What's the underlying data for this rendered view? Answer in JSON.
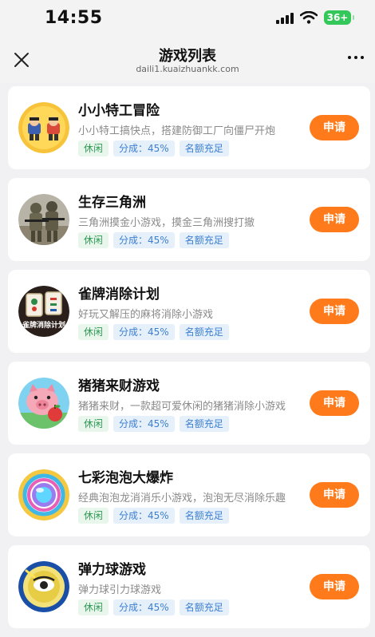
{
  "status_bar": {
    "time": "14:55",
    "battery": "36+",
    "icons": [
      "signal-icon",
      "wifi-icon",
      "battery-icon"
    ]
  },
  "nav": {
    "title": "游戏列表",
    "subtitle": "daili1.kuaizhuankk.com",
    "icons": [
      "close-icon",
      "more-icon"
    ]
  },
  "colors": {
    "accent": "#ff7a1a",
    "tag_green_bg": "#e8f6ec",
    "tag_green_text": "#2e9a55",
    "tag_blue_bg": "#e6f0fb",
    "tag_blue_text": "#3c7fd0",
    "background": "#f1f1f3"
  },
  "games": [
    {
      "name": "小小特工冒险",
      "desc": "小小特工搞快点，搭建防御工厂向僵尸开炮",
      "tags": [
        "休闲",
        "分成：45%",
        "名额充足"
      ],
      "button": "申请",
      "avatar_icon": "agents-icon"
    },
    {
      "name": "生存三角洲",
      "desc": "三角洲摸金小游戏，摸金三角洲搜打撤",
      "tags": [
        "休闲",
        "分成：45%",
        "名额充足"
      ],
      "button": "申请",
      "avatar_icon": "soldiers-icon"
    },
    {
      "name": "雀牌消除计划",
      "desc": "好玩又解压的麻将消除小游戏",
      "tags": [
        "休闲",
        "分成：45%",
        "名额充足"
      ],
      "button": "申请",
      "avatar_icon": "mahjong-icon",
      "avatar_text": "雀牌消除计划"
    },
    {
      "name": "猪猪来财游戏",
      "desc": "猪猪来财，一款超可爱休闲的猪猪消除小游戏",
      "tags": [
        "休闲",
        "分成：45%",
        "名额充足"
      ],
      "button": "申请",
      "avatar_icon": "pig-icon"
    },
    {
      "name": "七彩泡泡大爆炸",
      "desc": "经典泡泡龙消消乐小游戏，泡泡无尽消除乐趣",
      "tags": [
        "休闲",
        "分成：45%",
        "名额充足"
      ],
      "button": "申请",
      "avatar_icon": "bubble-icon"
    },
    {
      "name": "弹力球游戏",
      "desc": "弹力球引力球游戏",
      "tags": [
        "休闲",
        "分成：45%",
        "名额充足"
      ],
      "button": "申请",
      "avatar_icon": "ball-icon"
    }
  ]
}
